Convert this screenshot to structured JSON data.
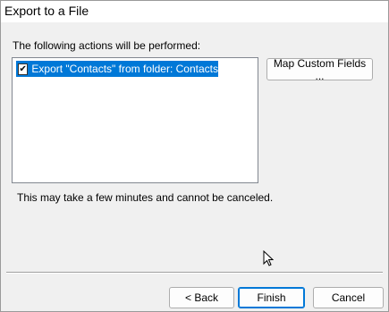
{
  "window": {
    "title": "Export to a File"
  },
  "main": {
    "caption": "The following actions will be performed:",
    "actions": [
      {
        "label": "Export \"Contacts\" from folder: Contacts",
        "checked": true,
        "selected": true
      }
    ],
    "map_button": "Map Custom Fields ...",
    "note": "This may take a few minutes and cannot be canceled."
  },
  "footer": {
    "back": "< Back",
    "finish": "Finish",
    "cancel": "Cancel"
  },
  "icons": {
    "checkbox": "checkmark-icon",
    "pointer": "mouse-pointer-icon"
  },
  "colors": {
    "selection": "#0078d7",
    "dialog_bg": "#f0f0f0",
    "default_button_border": "#0078d7"
  }
}
